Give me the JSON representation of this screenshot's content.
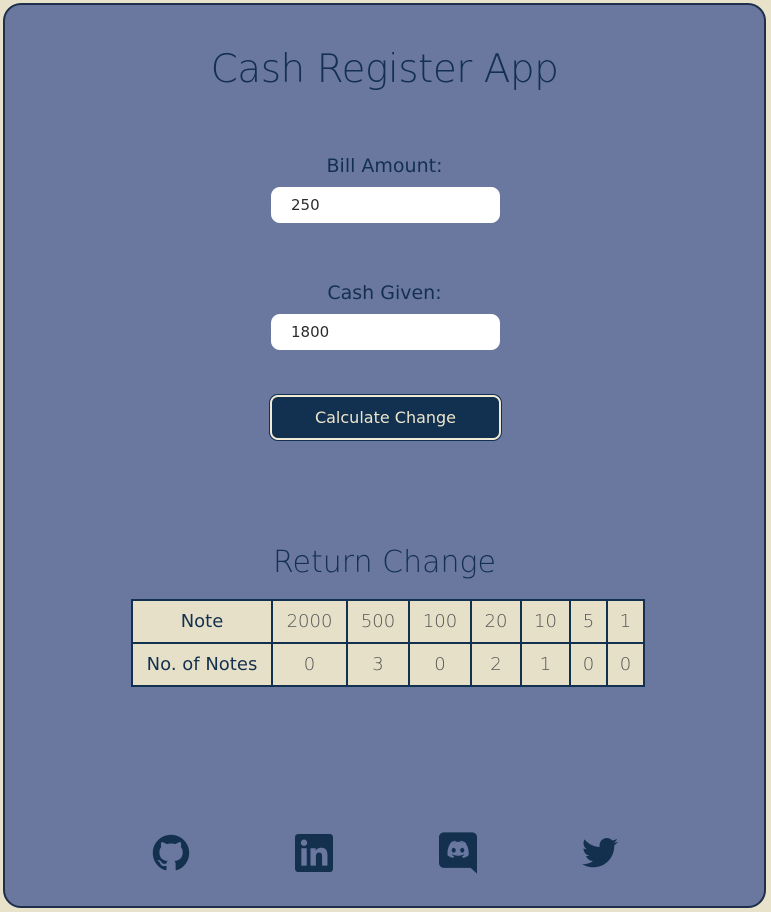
{
  "header": {
    "title": "Cash Register App"
  },
  "form": {
    "bill_label": "Bill Amount:",
    "bill_value": "250",
    "cash_label": "Cash Given:",
    "cash_value": "1800",
    "button_label": "Calculate Change"
  },
  "result": {
    "title": "Return Change",
    "row1_header": "Note",
    "row2_header": "No. of Notes",
    "notes": [
      "2000",
      "500",
      "100",
      "20",
      "10",
      "5",
      "1"
    ],
    "counts": [
      "0",
      "3",
      "0",
      "2",
      "1",
      "0",
      "0"
    ]
  },
  "footer": {
    "icons": [
      "github-icon",
      "linkedin-icon",
      "discord-icon",
      "twitter-icon"
    ]
  },
  "colors": {
    "background": "#e8e2cb",
    "card": "#6a78a0",
    "accent": "#12304f",
    "table_cell": "#e6e0c8"
  }
}
